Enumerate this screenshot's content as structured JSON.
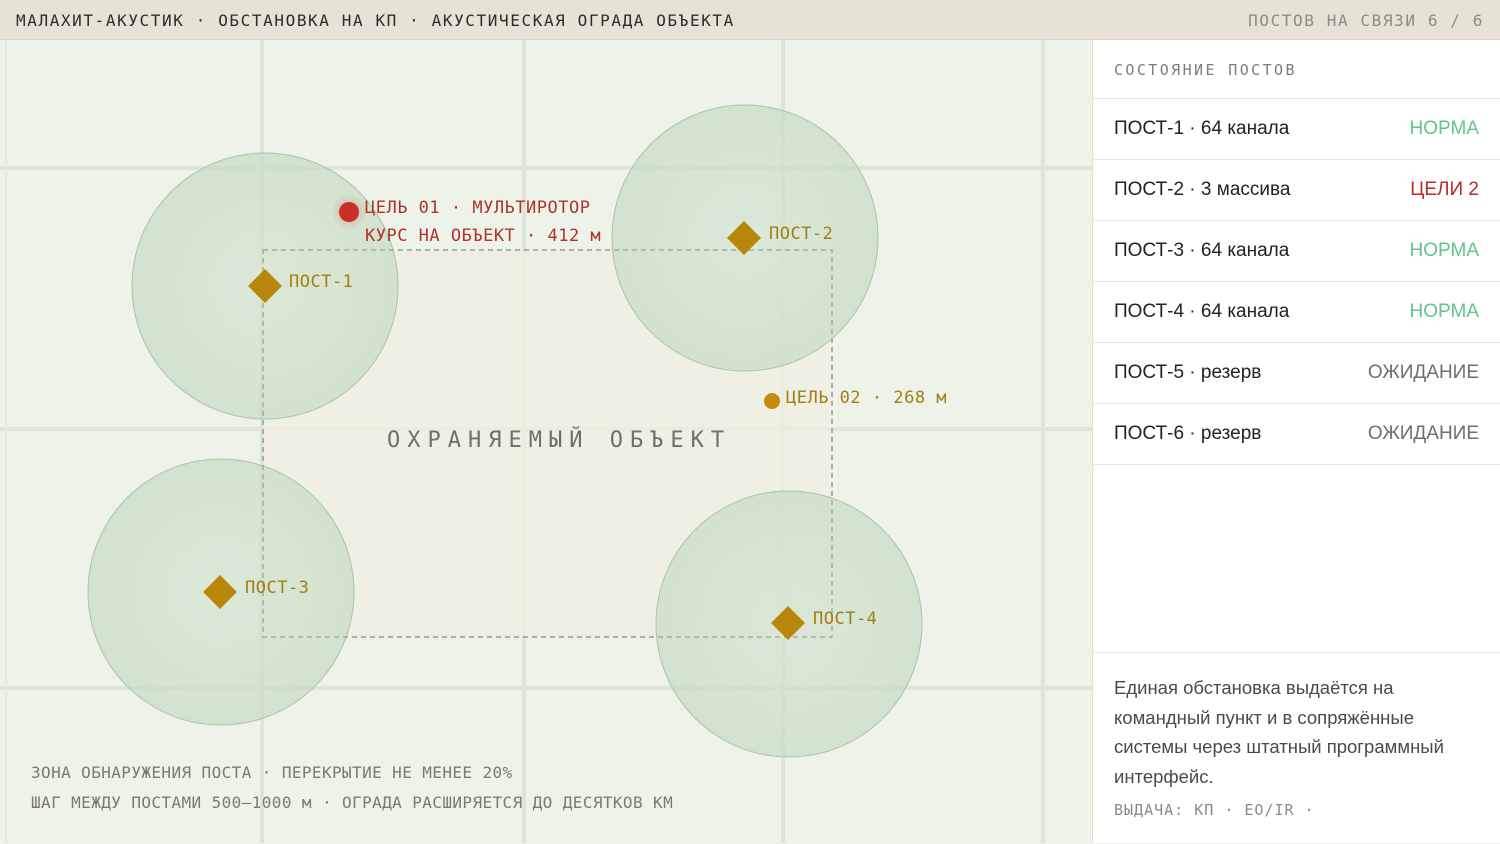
{
  "header": {
    "title": "МАЛАХИТ-АКУСТИК · ОБСТАНОВКА НА КП · АКУСТИЧЕСКАЯ ОГРАДА ОБЪЕКТА",
    "status": "ПОСТОВ НА СВЯЗИ 6 / 6"
  },
  "map": {
    "posts": [
      {
        "label": "ПОСТ-1"
      },
      {
        "label": "ПОСТ-2"
      },
      {
        "label": "ПОСТ-3"
      },
      {
        "label": "ПОСТ-4"
      }
    ],
    "target1": {
      "line1": "ЦЕЛЬ 01 · МУЛЬТИРОТОР",
      "line2": "КУРС НА ОБЪЕКТ · 412 м"
    },
    "target2": {
      "label": "ЦЕЛЬ 02 · 268 м"
    },
    "object_label": "ОХРАНЯЕМЫЙ ОБЪЕКТ",
    "footnote": {
      "line1": "ЗОНА ОБНАРУЖЕНИЯ ПОСТА · ПЕРЕКРЫТИЕ НЕ МЕНЕЕ 20%",
      "line2": "ШАГ МЕЖДУ ПОСТАМИ 500–1000 м · ОГРАДА РАСШИРЯЕТСЯ ДО ДЕСЯТКОВ КМ"
    },
    "colors": {
      "post": "#b8860b",
      "target_alert": "#c8302a",
      "target_track": "#c48a14",
      "zone": "#cfe0cc"
    }
  },
  "panel": {
    "heading": "СОСТОЯНИЕ ПОСТОВ",
    "posts": [
      {
        "name": "ПОСТ-1 · 64 канала",
        "state": "НОРМА"
      },
      {
        "name": "ПОСТ-2 · 3 массива",
        "state": "ЦЕЛИ 2"
      },
      {
        "name": "ПОСТ-3 · 64 канала",
        "state": "НОРМА"
      },
      {
        "name": "ПОСТ-4 · 64 канала",
        "state": "НОРМА"
      },
      {
        "name": "ПОСТ-5 · резерв",
        "state": "ОЖИДАНИЕ"
      },
      {
        "name": "ПОСТ-6 · резерв",
        "state": "ОЖИДАНИЕ"
      }
    ],
    "description": "Единая обстановка выдаётся на командный пункт и в сопряжённые системы через штатный программный интерфейс.",
    "meta": "ВЫДАЧА: КП · EO/IR ·"
  }
}
